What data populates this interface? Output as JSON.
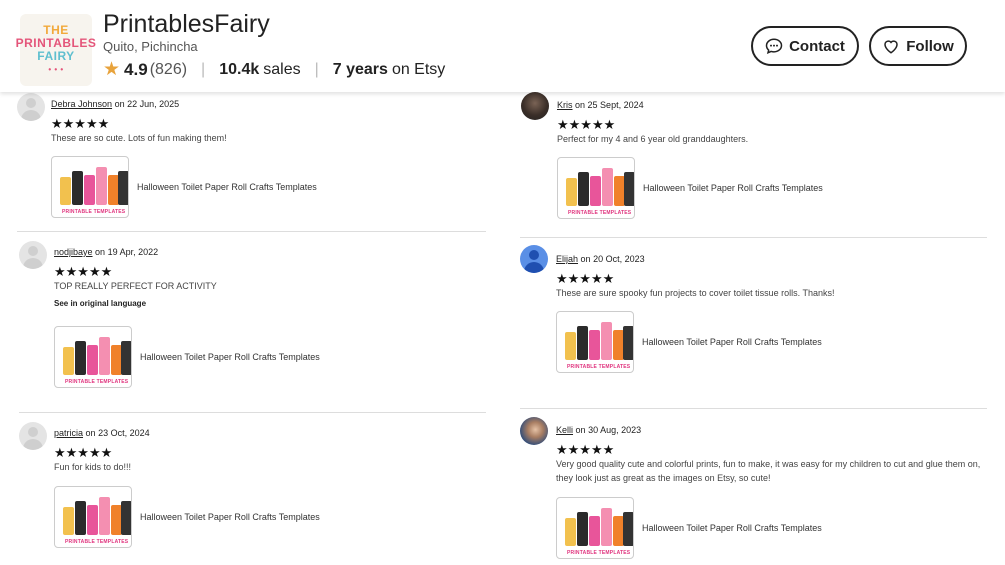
{
  "shop": {
    "name": "PrintablesFairy",
    "location": "Quito, Pichincha",
    "rating": "4.9",
    "review_count": "(826)",
    "sales_value": "10.4k",
    "sales_label": "sales",
    "years_value": "7 years",
    "years_label": "on Etsy",
    "logo": {
      "line1": "THE",
      "line2": "PRINTABLES",
      "line3": "FAIRY"
    }
  },
  "buttons": {
    "contact": "Contact",
    "follow": "Follow"
  },
  "stars": "★★★★★",
  "on": "on",
  "product_title": "Halloween Toilet Paper Roll Crafts Templates",
  "thumb_caption": "PRINTABLE TEMPLATES",
  "reviews": [
    {
      "user": "Debra Johnson",
      "date": "22 Jun, 2025",
      "text": "These are so cute. Lots of fun making them!"
    },
    {
      "user": "nodjibaye",
      "date": "19 Apr, 2022",
      "text": "TOP REALLY PERFECT FOR ACTIVITY",
      "see_original": "See in original language"
    },
    {
      "user": "patricia",
      "date": "23 Oct, 2024",
      "text": "Fun for kids to do!!!"
    },
    {
      "user": "Kris",
      "date": "25 Sept, 2024",
      "text": "Perfect for my 4 and 6 year old granddaughters."
    },
    {
      "user": "Elijah",
      "date": "20 Oct, 2023",
      "text": "These are sure spooky fun projects to cover toilet tissue rolls. Thanks!"
    },
    {
      "user": "Kelli",
      "date": "30 Aug, 2023",
      "text": "Very good quality cute and colorful prints, fun to make, it was easy for my children to cut and glue them on, they look just as great as the images on Etsy, so cute!"
    }
  ],
  "colors": {
    "star": "#e8a33c",
    "border": "#222222",
    "divider": "#dddddd"
  }
}
